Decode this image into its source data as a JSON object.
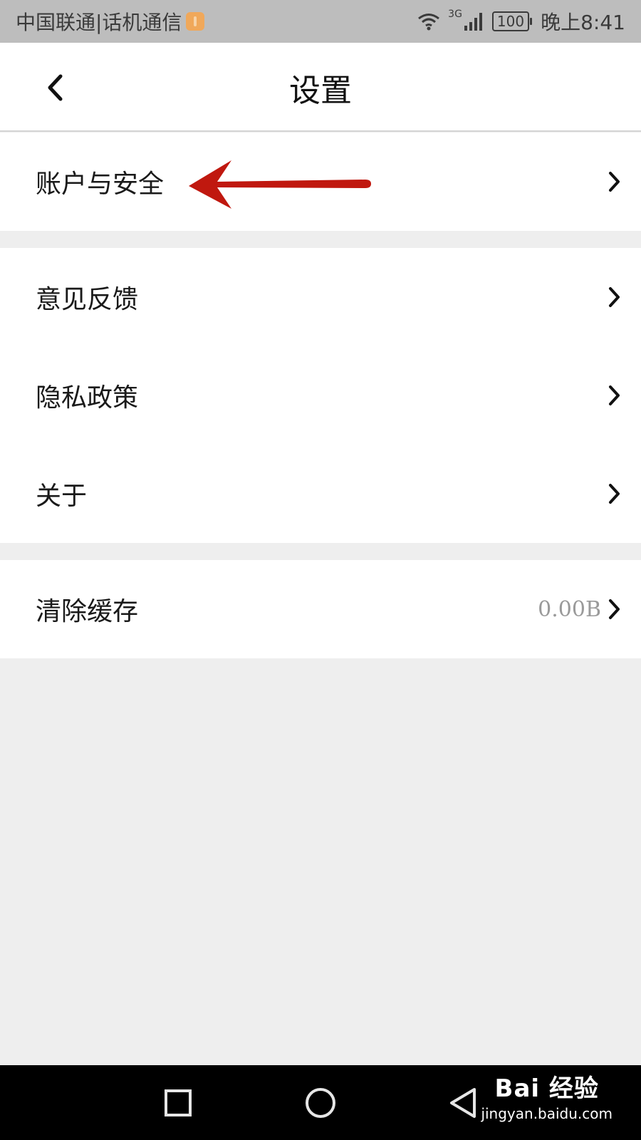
{
  "status_bar": {
    "carrier": "中国联通|话机通信",
    "network": "3G",
    "battery": "100",
    "time": "晚上8:41"
  },
  "header": {
    "title": "设置"
  },
  "groups": [
    {
      "items": [
        {
          "label": "账户与安全"
        }
      ]
    },
    {
      "items": [
        {
          "label": "意见反馈"
        },
        {
          "label": "隐私政策"
        },
        {
          "label": "关于"
        }
      ]
    },
    {
      "items": [
        {
          "label": "清除缓存",
          "value": "0.00B"
        }
      ]
    }
  ],
  "watermark": {
    "logo": "Bai 经验",
    "url": "jingyan.baidu.com"
  },
  "colors": {
    "background": "#eeeeee",
    "status_bar": "#bdbdbd",
    "annotation_arrow": "#c0180f"
  },
  "icons": {
    "back": "chevron-left-icon",
    "row": "chevron-right-icon",
    "annotation": "red-arrow-icon"
  }
}
